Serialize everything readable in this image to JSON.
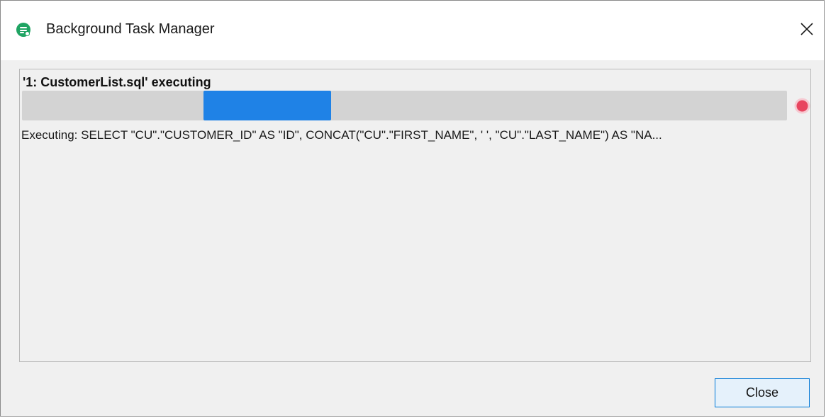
{
  "window": {
    "title": "Background Task Manager",
    "icon": "database-search-icon",
    "close_icon": "close-icon"
  },
  "task": {
    "name": "'1: CustomerList.sql' executing",
    "status": "Executing: SELECT \"CU\".\"CUSTOMER_ID\" AS \"ID\", CONCAT(\"CU\".\"FIRST_NAME\", ' ', \"CU\".\"LAST_NAME\") AS \"NA...",
    "progress_mode": "indeterminate",
    "stop_icon": "stop-icon"
  },
  "footer": {
    "close_label": "Close"
  },
  "colors": {
    "progress_fill": "#1f82e6",
    "progress_track": "#d3d3d3",
    "stop_icon": "#e8455f",
    "app_icon": "#1fa463",
    "button_border": "#0078d7"
  }
}
